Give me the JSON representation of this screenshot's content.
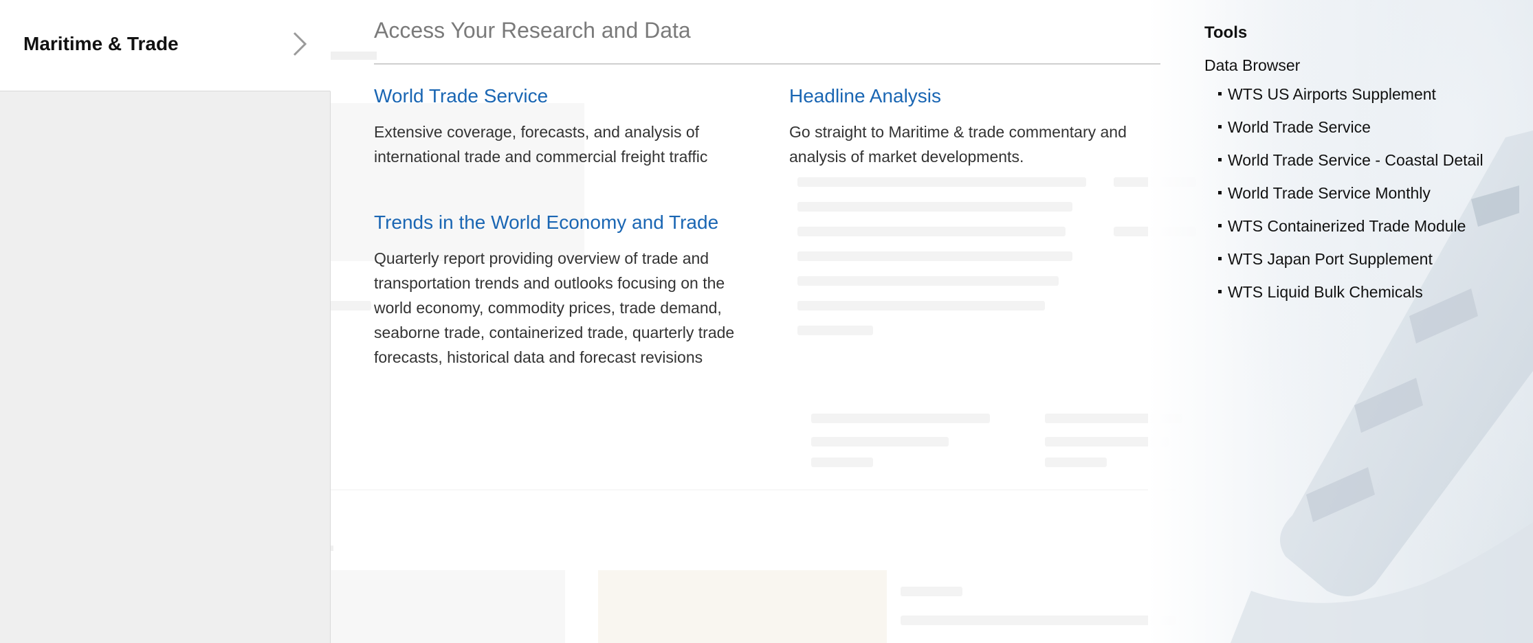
{
  "sidebar": {
    "active_category": "Maritime & Trade"
  },
  "main": {
    "title": "Access Your Research and Data",
    "items": [
      {
        "title": "World Trade Service",
        "description": "Extensive coverage, forecasts, and analysis of international trade and commercial freight traffic"
      },
      {
        "title": "Headline Analysis",
        "description": "Go straight to Maritime & trade commentary and analysis of market developments."
      },
      {
        "title": "Trends in the World Economy and Trade",
        "description": "Quarterly report providing overview of trade and transportation trends and outlooks focusing on the world economy, commodity prices, trade demand, seaborne trade, containerized trade, quarterly trade forecasts, historical data and forecast revisions"
      }
    ]
  },
  "tools": {
    "heading": "Tools",
    "data_browser_label": "Data Browser",
    "items": [
      "WTS US Airports Supplement",
      "World Trade Service",
      "World Trade Service - Coastal Detail",
      "World Trade Service Monthly",
      "WTS Containerized Trade Module",
      "WTS Japan Port Supplement",
      "WTS Liquid Bulk Chemicals"
    ]
  },
  "colors": {
    "link": "#1a66b3",
    "panel_bg": "#efefef"
  }
}
